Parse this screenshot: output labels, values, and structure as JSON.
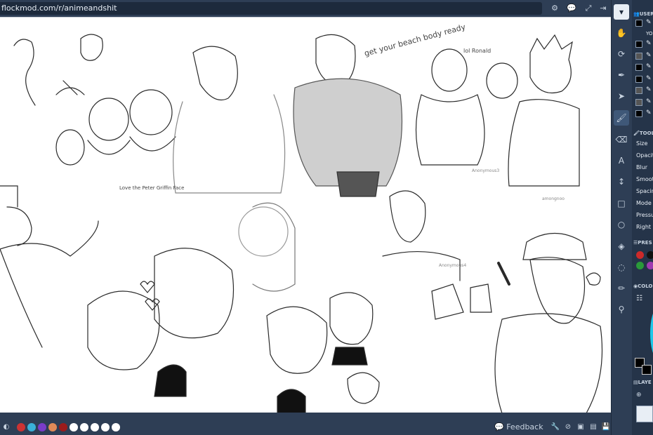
{
  "topbar": {
    "url": "flockmod.com/r/animeandshit",
    "icons": [
      "gear-icon",
      "chat-icon",
      "fullscreen-icon",
      "logout-icon"
    ]
  },
  "canvas": {
    "background": "#ffffff",
    "drawn_labels": [
      "get your beach body ready",
      "lol Ronald",
      "Love the Peter Griffin Face",
      "Anonymous3",
      "Anonymous4",
      "amongnoo"
    ]
  },
  "bottombar": {
    "palette": [
      "#cc3333",
      "#3ab0d8",
      "#7a3cc8",
      "#e08a58",
      "#9b1b1b",
      "#ffffff",
      "#ffffff",
      "#ffffff",
      "#ffffff",
      "#ffffff"
    ],
    "feedback_label": "Feedback",
    "icons": [
      "wrench-icon",
      "no-entry-icon",
      "image-icon",
      "save-icon"
    ]
  },
  "tools": [
    "collapse-icon",
    "hand-icon",
    "rotate-icon",
    "pen-icon",
    "pointer-icon",
    "brush-icon",
    "eraser-icon",
    "text-icon",
    "move-icon",
    "rect-icon",
    "ellipse-icon",
    "fill-icon",
    "lasso-icon",
    "pencil-icon",
    "eyedropper-icon"
  ],
  "panel": {
    "users_title": "USER",
    "you_label": "YO",
    "users": [
      "#000000",
      "#000000",
      "#555555",
      "#000000",
      "#000000",
      "#555555",
      "#555555",
      "#000000"
    ],
    "tool_title": "TOOL",
    "tool_settings": [
      "Size",
      "Opacity",
      "Blur",
      "Smooth",
      "Spacing",
      "Mode",
      "Pressure",
      "Right"
    ],
    "presets_title": "PRES",
    "preset_colors": [
      "#cc2a2a",
      "#111111",
      "#2a9a3a",
      "#a03ab0"
    ],
    "color_title": "COLO",
    "layers_title": "LAYE"
  }
}
